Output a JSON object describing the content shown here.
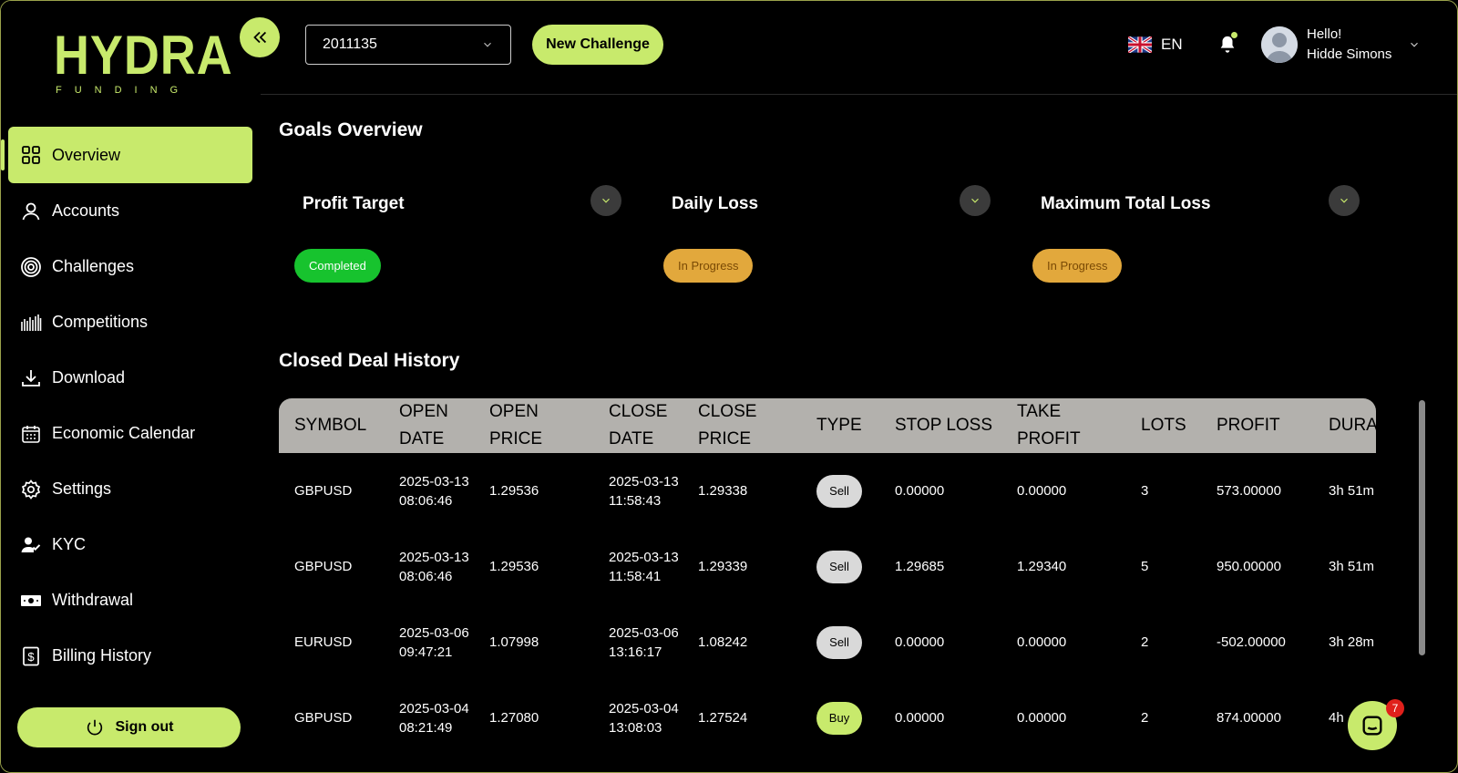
{
  "brand": {
    "name": "HYDRA",
    "sub": "FUNDING",
    "accent": "#c8ea6c"
  },
  "sidebar": {
    "items": [
      {
        "label": "Overview",
        "icon": "grid-icon",
        "active": true
      },
      {
        "label": "Accounts",
        "icon": "user-icon"
      },
      {
        "label": "Challenges",
        "icon": "target-icon"
      },
      {
        "label": "Competitions",
        "icon": "bars-icon"
      },
      {
        "label": "Download",
        "icon": "download-icon"
      },
      {
        "label": "Economic Calendar",
        "icon": "calendar-icon"
      },
      {
        "label": "Settings",
        "icon": "gear-icon"
      },
      {
        "label": "KYC",
        "icon": "user-check-icon"
      },
      {
        "label": "Withdrawal",
        "icon": "cash-icon"
      },
      {
        "label": "Billing History",
        "icon": "invoice-icon"
      }
    ],
    "signout_label": "Sign out"
  },
  "topbar": {
    "account_value": "2011135",
    "new_challenge_label": "New Challenge",
    "language": "EN",
    "greeting": "Hello!",
    "user_name": "Hidde Simons"
  },
  "goals": {
    "title": "Goals Overview",
    "items": [
      {
        "title": "Profit Target",
        "status": "Completed",
        "status_color": "#17c32e"
      },
      {
        "title": "Daily Loss",
        "status": "In Progress",
        "status_color": "#e2a83c"
      },
      {
        "title": "Maximum Total Loss",
        "status": "In Progress",
        "status_color": "#e2a83c"
      }
    ]
  },
  "deals": {
    "title": "Closed Deal History",
    "columns": [
      "SYMBOL",
      "OPEN DATE",
      "OPEN PRICE",
      "CLOSE DATE",
      "CLOSE PRICE",
      "TYPE",
      "STOP LOSS",
      "TAKE PROFIT",
      "LOTS",
      "PROFIT",
      "DURA"
    ],
    "rows": [
      [
        "GBPUSD",
        "2025-03-13 08:06:46",
        "1.29536",
        "2025-03-13 11:58:43",
        "1.29338",
        "Sell",
        "0.00000",
        "0.00000",
        "3",
        "573.00000",
        "3h 51m"
      ],
      [
        "GBPUSD",
        "2025-03-13 08:06:46",
        "1.29536",
        "2025-03-13 11:58:41",
        "1.29339",
        "Sell",
        "1.29685",
        "1.29340",
        "5",
        "950.00000",
        "3h 51m"
      ],
      [
        "EURUSD",
        "2025-03-06 09:47:21",
        "1.07998",
        "2025-03-06 13:16:17",
        "1.08242",
        "Sell",
        "0.00000",
        "0.00000",
        "2",
        "-502.00000",
        "3h 28m"
      ],
      [
        "GBPUSD",
        "2025-03-04 08:21:49",
        "1.27080",
        "2025-03-04 13:08:03",
        "1.27524",
        "Buy",
        "0.00000",
        "0.00000",
        "2",
        "874.00000",
        "4h"
      ]
    ]
  },
  "chat": {
    "unread": "7"
  }
}
